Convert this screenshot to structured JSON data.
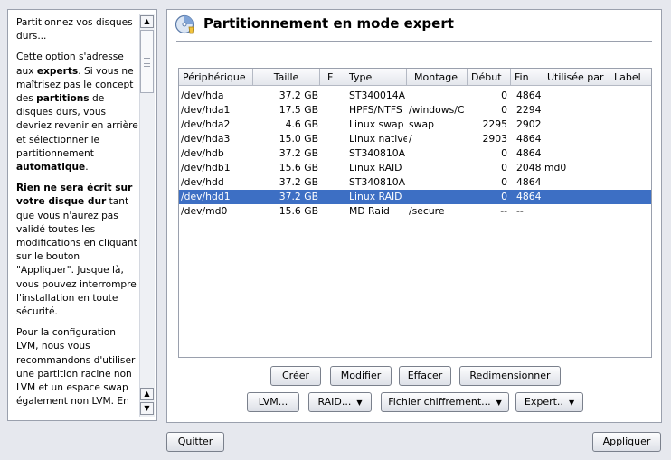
{
  "help": {
    "p1": "Partitionnez vos disques durs...",
    "p2_pre": "Cette option s'adresse aux ",
    "p2_b1": "experts",
    "p2_mid": ". Si vous ne maîtrisez pas le concept des ",
    "p2_b2": "partitions",
    "p2_mid2": " de disques durs, vous devriez revenir en arrière et sélectionner le partitionnement ",
    "p2_b3": "automatique",
    "p2_end": ".",
    "p3_b": "Rien ne sera écrit sur votre disque dur",
    "p3_rest": " tant que vous n'aurez pas validé toutes les modifications en cliquant sur le bouton \"Appliquer\". Jusque là, vous pouvez interrompre l'installation en toute sécurité.",
    "p4": "Pour la configuration LVM, nous vous recommandons d'utiliser une partition racine non LVM et un espace swap également non LVM. En"
  },
  "header": {
    "title": "Partitionnement en mode expert"
  },
  "table": {
    "columns": [
      "Périphérique",
      "Taille",
      "F",
      "Type",
      "Montage",
      "Début",
      "Fin",
      "Utilisée par",
      "Label"
    ],
    "rows": [
      {
        "device": "/dev/hda",
        "size": "37.2 GB",
        "f": "",
        "type": "ST340014A",
        "mount": "",
        "start": "0",
        "end": "4864",
        "used_by": "",
        "label": ""
      },
      {
        "device": "/dev/hda1",
        "size": "17.5 GB",
        "f": "",
        "type": "HPFS/NTFS",
        "mount": "/windows/C",
        "start": "0",
        "end": "2294",
        "used_by": "",
        "label": ""
      },
      {
        "device": "/dev/hda2",
        "size": "4.6 GB",
        "f": "",
        "type": "Linux swap",
        "mount": "swap",
        "start": "2295",
        "end": "2902",
        "used_by": "",
        "label": ""
      },
      {
        "device": "/dev/hda3",
        "size": "15.0 GB",
        "f": "",
        "type": "Linux native",
        "mount": "/",
        "start": "2903",
        "end": "4864",
        "used_by": "",
        "label": ""
      },
      {
        "device": "/dev/hdb",
        "size": "37.2 GB",
        "f": "",
        "type": "ST340810A",
        "mount": "",
        "start": "0",
        "end": "4864",
        "used_by": "",
        "label": ""
      },
      {
        "device": "/dev/hdb1",
        "size": "15.6 GB",
        "f": "",
        "type": "Linux RAID",
        "mount": "",
        "start": "0",
        "end": "2048",
        "used_by": "md0",
        "label": ""
      },
      {
        "device": "/dev/hdd",
        "size": "37.2 GB",
        "f": "",
        "type": "ST340810A",
        "mount": "",
        "start": "0",
        "end": "4864",
        "used_by": "",
        "label": ""
      },
      {
        "device": "/dev/hdd1",
        "size": "37.2 GB",
        "f": "",
        "type": "Linux RAID",
        "mount": "",
        "start": "0",
        "end": "4864",
        "used_by": "",
        "label": ""
      },
      {
        "device": "/dev/md0",
        "size": "15.6 GB",
        "f": "",
        "type": "MD Raid",
        "mount": "/secure",
        "start": "--",
        "end": "--",
        "used_by": "",
        "label": ""
      }
    ],
    "selected_index": 7
  },
  "buttons": {
    "create": "Créer",
    "modify": "Modifier",
    "delete": "Effacer",
    "resize": "Redimensionner",
    "lvm": "LVM...",
    "raid": "RAID...",
    "crypt": "Fichier chiffrement...",
    "expert": "Expert..",
    "quit": "Quitter",
    "apply": "Appliquer"
  },
  "colors": {
    "selection": "#3d6fc4",
    "background": "#e6e8ee"
  }
}
